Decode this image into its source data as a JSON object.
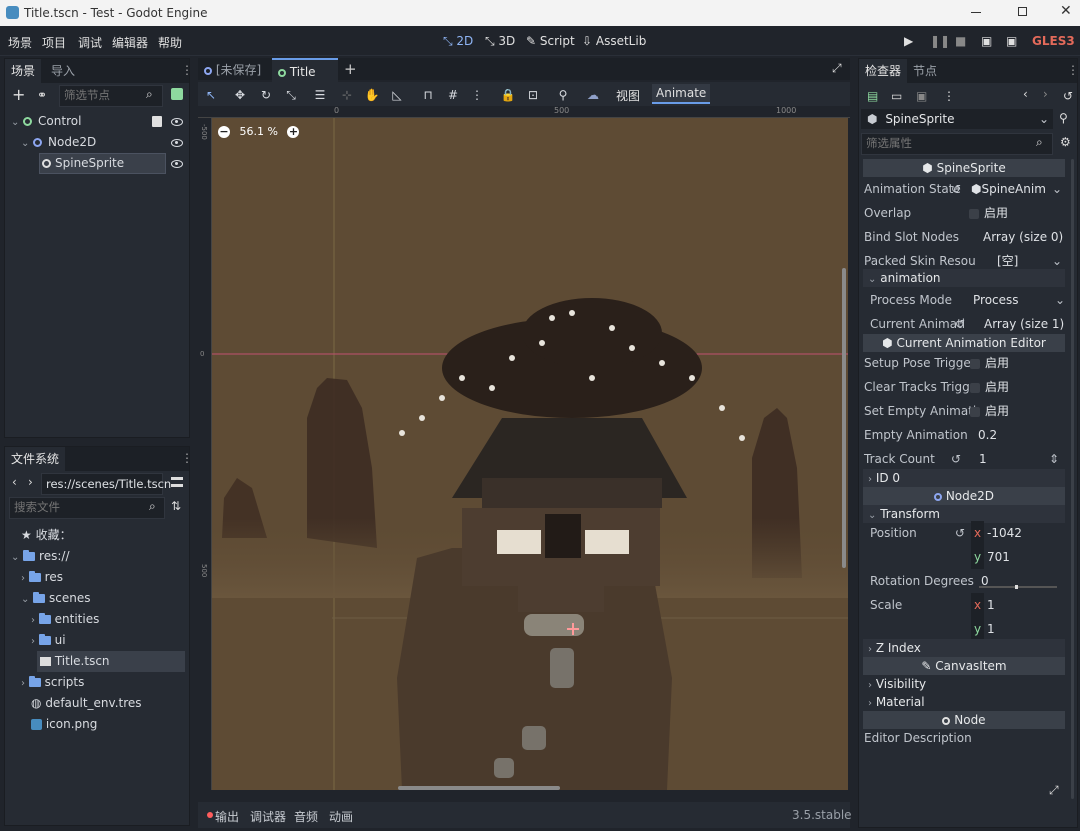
{
  "window": {
    "title": "Title.tscn - Test - Godot Engine"
  },
  "menu": {
    "items": [
      "场景",
      "项目",
      "调试",
      "编辑器",
      "帮助"
    ],
    "workspaces": [
      "2D",
      "3D",
      "Script",
      "AssetLib"
    ],
    "renderer": "GLES3"
  },
  "scene_panel": {
    "tabs": [
      "场景",
      "导入"
    ],
    "filter_placeholder": "筛选节点",
    "nodes": [
      "Control",
      "Node2D",
      "SpineSprite"
    ]
  },
  "filesystem": {
    "tab": "文件系统",
    "path": "res://scenes/Title.tscn",
    "search_placeholder": "搜索文件",
    "favorites": "收藏：",
    "items": [
      "res://",
      "res",
      "scenes",
      "entities",
      "ui",
      "Title.tscn",
      "scripts",
      "default_env.tres",
      "icon.png"
    ]
  },
  "editor": {
    "tabs": [
      "[未保存]",
      "Title"
    ],
    "toolbar_view": "视图",
    "toolbar_animate": "Animate",
    "zoom": "56.1 %",
    "ruler_labels": [
      "0",
      "500",
      "1000"
    ],
    "vruler_labels": [
      "-500",
      "0",
      "500"
    ]
  },
  "bottom": {
    "tabs": [
      "输出",
      "调试器",
      "音频",
      "动画"
    ],
    "version": "3.5.stable"
  },
  "inspector": {
    "tabs": [
      "检查器",
      "节点"
    ],
    "node_name": "SpineSprite",
    "filter_placeholder": "筛选属性",
    "sections": {
      "spine": "SpineSprite",
      "anim_editor": "Current Animation Editor",
      "node2d": "Node2D",
      "canvas": "CanvasItem",
      "node": "Node"
    },
    "props": {
      "animation_state": "Animation State",
      "animation_state_val": "SpineAnim",
      "overlap": "Overlap",
      "bind_slot": "Bind Slot Nodes",
      "bind_slot_val": "Array (size 0)",
      "packed_skin": "Packed Skin Resou",
      "packed_skin_val": "[空]",
      "animation": "animation",
      "process_mode": "Process Mode",
      "process_mode_val": "Process",
      "current_anim": "Current Animati",
      "current_anim_val": "Array (size 1)",
      "setup_pose": "Setup Pose Trigge",
      "clear_tracks": "Clear Tracks Trigg",
      "set_empty": "Set Empty Animati",
      "empty_anim": "Empty Animation",
      "empty_anim_val": "0.2",
      "track_count": "Track Count",
      "track_count_val": "1",
      "id0": "ID 0",
      "transform": "Transform",
      "position": "Position",
      "pos_x": "-1042",
      "pos_y": "701",
      "rotation": "Rotation Degrees",
      "rotation_val": "0",
      "scale": "Scale",
      "scale_x": "1",
      "scale_y": "1",
      "zindex": "Z Index",
      "visibility": "Visibility",
      "material": "Material",
      "editor_desc": "Editor Description",
      "enable": "启用",
      "x": "x",
      "y": "y"
    }
  },
  "colors": {
    "accent": "#699ce8",
    "bg": "#20242b",
    "panel": "#262b33",
    "viewport": "#5e4b34"
  }
}
